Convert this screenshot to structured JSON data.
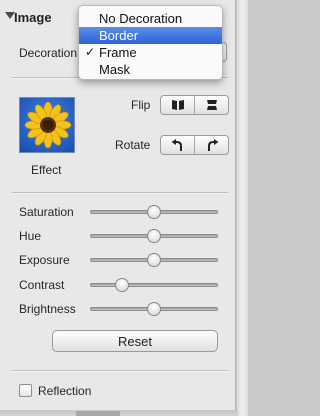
{
  "panel": {
    "section_title": "Image",
    "decoration_label": "Decoration",
    "decoration_menu": {
      "items": [
        {
          "label": "No Decoration",
          "checked": false,
          "highlighted": false
        },
        {
          "label": "Border",
          "checked": false,
          "highlighted": true
        },
        {
          "label": "Frame",
          "checked": true,
          "highlighted": false
        },
        {
          "label": "Mask",
          "checked": false,
          "highlighted": false
        }
      ],
      "check_glyph": "✓"
    },
    "effect_label": "Effect",
    "effect_thumbnail_icon": "sunflower-icon",
    "flip": {
      "label": "Flip",
      "icons": [
        "flip-horizontal-icon",
        "flip-vertical-icon"
      ]
    },
    "rotate": {
      "label": "Rotate",
      "icons": [
        "rotate-left-icon",
        "rotate-right-icon"
      ]
    },
    "sliders": [
      {
        "label": "Saturation",
        "level": 0.5
      },
      {
        "label": "Hue",
        "level": 0.5
      },
      {
        "label": "Exposure",
        "level": 0.5
      },
      {
        "label": "Contrast",
        "level": 0.22
      },
      {
        "label": "Brightness",
        "level": 0.5
      }
    ],
    "reset_label": "Reset",
    "reflection": {
      "label": "Reflection",
      "checked": false
    }
  },
  "colors": {
    "menu_highlight": "#3a6ee0",
    "panel_bg": "#e8e8e8"
  }
}
